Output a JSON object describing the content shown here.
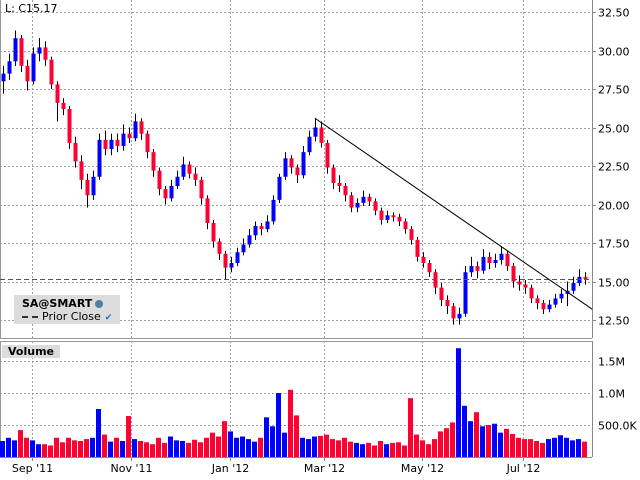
{
  "header": {
    "last_label": "L: C15.17"
  },
  "legend": {
    "symbol": "SA@SMART",
    "prior_close_label": "Prior Close"
  },
  "volume_panel": {
    "title": "Volume"
  },
  "colors": {
    "up": "#0000ff",
    "down": "#ff0033",
    "neutral": "#000000",
    "grid": "#a0a0a0"
  },
  "chart_data": {
    "type": "candlestick",
    "price_axis": {
      "ylim": [
        11.5,
        33.25
      ],
      "ticks": [
        "32.50",
        "30.00",
        "27.50",
        "25.00",
        "22.50",
        "20.00",
        "17.50",
        "15.00",
        "12.50"
      ],
      "tick_values": [
        32.5,
        30,
        27.5,
        25,
        22.5,
        20,
        17.5,
        15,
        12.5
      ]
    },
    "volume_axis": {
      "ylim": [
        0,
        1.8
      ],
      "unit": "M",
      "ticks": [
        "1.5M",
        "1.0M",
        "500.0K"
      ],
      "tick_values": [
        1.5,
        1.0,
        0.5
      ]
    },
    "x_ticks": [
      {
        "label": "Sep '11",
        "index": 4.8
      },
      {
        "label": "Nov '11",
        "index": 21.3
      },
      {
        "label": "Jan '12",
        "index": 37.8
      },
      {
        "label": "Mar '12",
        "index": 53.5
      },
      {
        "label": "May '12",
        "index": 69.8
      },
      {
        "label": "Jul '12",
        "index": 86.7
      }
    ],
    "prior_close": 15.17,
    "trendline": {
      "from": {
        "index": 52,
        "price": 25.6
      },
      "to": {
        "index": 98.2,
        "price": 13.2
      }
    },
    "ohlc": [
      [
        28.0,
        29.0,
        27.2,
        28.5
      ],
      [
        28.5,
        29.8,
        28.1,
        29.3
      ],
      [
        29.3,
        31.3,
        29.0,
        30.8
      ],
      [
        30.8,
        31.0,
        28.6,
        29.0
      ],
      [
        29.0,
        29.4,
        27.4,
        28.0
      ],
      [
        28.0,
        30.2,
        27.8,
        29.8
      ],
      [
        29.8,
        30.8,
        29.3,
        30.2
      ],
      [
        30.2,
        30.6,
        29.0,
        29.4
      ],
      [
        29.4,
        29.6,
        27.5,
        27.8
      ],
      [
        27.8,
        28.0,
        25.4,
        26.6
      ],
      [
        26.6,
        26.9,
        25.8,
        26.2
      ],
      [
        26.2,
        26.4,
        23.6,
        24.0
      ],
      [
        24.0,
        24.4,
        22.4,
        22.8
      ],
      [
        22.8,
        23.2,
        21.0,
        21.6
      ],
      [
        21.6,
        22.0,
        19.8,
        20.6
      ],
      [
        20.6,
        22.2,
        20.3,
        21.8
      ],
      [
        21.8,
        24.6,
        21.6,
        24.2
      ],
      [
        24.2,
        24.8,
        23.2,
        23.6
      ],
      [
        23.6,
        24.6,
        23.2,
        24.2
      ],
      [
        24.2,
        24.6,
        23.4,
        23.8
      ],
      [
        23.8,
        25.2,
        23.5,
        24.6
      ],
      [
        24.6,
        25.0,
        24.0,
        24.3
      ],
      [
        24.3,
        25.9,
        24.1,
        25.4
      ],
      [
        25.4,
        25.6,
        24.2,
        24.6
      ],
      [
        24.6,
        24.8,
        23.0,
        23.4
      ],
      [
        23.4,
        23.6,
        21.8,
        22.2
      ],
      [
        22.2,
        22.4,
        20.6,
        21.0
      ],
      [
        21.0,
        21.2,
        20.0,
        20.4
      ],
      [
        20.4,
        21.6,
        20.2,
        21.2
      ],
      [
        21.2,
        22.2,
        21.0,
        21.8
      ],
      [
        21.8,
        23.1,
        21.6,
        22.6
      ],
      [
        22.6,
        22.8,
        21.7,
        22.0
      ],
      [
        22.0,
        22.4,
        21.2,
        21.6
      ],
      [
        21.6,
        21.8,
        20.0,
        20.4
      ],
      [
        20.4,
        20.6,
        18.4,
        18.8
      ],
      [
        18.8,
        19.0,
        17.2,
        17.6
      ],
      [
        17.6,
        17.8,
        16.4,
        16.8
      ],
      [
        16.8,
        17.0,
        15.1,
        15.9
      ],
      [
        15.9,
        16.6,
        15.6,
        16.2
      ],
      [
        16.2,
        17.2,
        16.0,
        16.9
      ],
      [
        16.9,
        17.8,
        16.7,
        17.4
      ],
      [
        17.4,
        18.4,
        17.2,
        18.0
      ],
      [
        18.0,
        18.9,
        17.7,
        18.6
      ],
      [
        18.6,
        18.8,
        18.0,
        18.4
      ],
      [
        18.4,
        19.3,
        18.2,
        18.9
      ],
      [
        18.9,
        20.6,
        18.7,
        20.3
      ],
      [
        20.3,
        22.0,
        20.1,
        21.8
      ],
      [
        21.8,
        23.4,
        21.6,
        23.0
      ],
      [
        23.0,
        23.2,
        22.0,
        22.4
      ],
      [
        22.4,
        22.6,
        21.4,
        21.9
      ],
      [
        21.9,
        23.8,
        21.7,
        23.4
      ],
      [
        23.4,
        24.8,
        23.2,
        24.4
      ],
      [
        24.4,
        25.6,
        24.1,
        25.0
      ],
      [
        25.0,
        25.4,
        23.7,
        24.0
      ],
      [
        24.0,
        24.2,
        22.0,
        22.4
      ],
      [
        22.4,
        22.6,
        21.0,
        21.4
      ],
      [
        21.4,
        21.9,
        20.8,
        21.2
      ],
      [
        21.2,
        21.4,
        20.2,
        20.6
      ],
      [
        20.6,
        20.8,
        19.5,
        19.8
      ],
      [
        19.8,
        20.4,
        19.5,
        20.1
      ],
      [
        20.1,
        20.9,
        19.9,
        20.5
      ],
      [
        20.5,
        20.7,
        19.9,
        20.2
      ],
      [
        20.2,
        20.4,
        19.3,
        19.6
      ],
      [
        19.6,
        19.8,
        18.7,
        19.0
      ],
      [
        19.0,
        19.6,
        18.8,
        19.3
      ],
      [
        19.3,
        19.5,
        18.9,
        19.2
      ],
      [
        19.2,
        19.4,
        18.6,
        18.9
      ],
      [
        18.9,
        19.1,
        18.1,
        18.4
      ],
      [
        18.4,
        18.6,
        17.4,
        17.7
      ],
      [
        17.7,
        17.9,
        16.3,
        16.6
      ],
      [
        16.6,
        16.9,
        15.9,
        16.2
      ],
      [
        16.2,
        16.4,
        15.3,
        15.6
      ],
      [
        15.6,
        15.8,
        14.2,
        14.6
      ],
      [
        14.6,
        14.9,
        13.4,
        13.8
      ],
      [
        13.8,
        14.1,
        12.9,
        13.4
      ],
      [
        13.4,
        13.6,
        12.2,
        12.6
      ],
      [
        12.6,
        13.3,
        12.2,
        12.9
      ],
      [
        12.9,
        16.0,
        12.7,
        15.6
      ],
      [
        15.6,
        16.6,
        15.3,
        16.0
      ],
      [
        16.0,
        16.3,
        15.2,
        15.7
      ],
      [
        15.7,
        17.1,
        15.5,
        16.6
      ],
      [
        16.6,
        16.9,
        15.8,
        16.2
      ],
      [
        16.2,
        16.8,
        15.9,
        16.4
      ],
      [
        16.4,
        17.3,
        16.1,
        16.8
      ],
      [
        16.8,
        17.0,
        15.7,
        16.0
      ],
      [
        16.0,
        16.2,
        14.6,
        15.0
      ],
      [
        15.0,
        15.4,
        14.4,
        14.8
      ],
      [
        14.8,
        15.1,
        14.2,
        14.6
      ],
      [
        14.6,
        14.8,
        13.6,
        13.9
      ],
      [
        13.9,
        14.1,
        13.2,
        13.6
      ],
      [
        13.6,
        13.8,
        12.9,
        13.2
      ],
      [
        13.2,
        13.8,
        13.0,
        13.5
      ],
      [
        13.5,
        14.2,
        13.3,
        13.9
      ],
      [
        13.9,
        14.5,
        13.6,
        14.2
      ],
      [
        14.2,
        15.0,
        13.4,
        14.4
      ],
      [
        14.4,
        15.3,
        14.2,
        14.9
      ],
      [
        14.9,
        15.8,
        14.7,
        15.3
      ],
      [
        15.3,
        15.6,
        14.8,
        15.17
      ]
    ],
    "volume_k": [
      250,
      300,
      260,
      420,
      300,
      260,
      200,
      200,
      180,
      300,
      230,
      300,
      260,
      250,
      280,
      300,
      750,
      350,
      240,
      300,
      250,
      640,
      280,
      250,
      230,
      200,
      300,
      220,
      320,
      260,
      250,
      220,
      270,
      230,
      300,
      380,
      320,
      560,
      400,
      300,
      320,
      280,
      240,
      300,
      620,
      480,
      1000,
      380,
      1050,
      650,
      300,
      280,
      320,
      330,
      350,
      280,
      260,
      300,
      240,
      220,
      200,
      220,
      180,
      250,
      200,
      220,
      230,
      180,
      920,
      350,
      260,
      200,
      280,
      400,
      450,
      540,
      1700,
      800,
      560,
      700,
      480,
      500,
      520,
      380,
      440,
      360,
      300,
      280,
      280,
      250,
      220,
      280,
      300,
      340,
      300,
      260,
      280,
      240
    ]
  }
}
